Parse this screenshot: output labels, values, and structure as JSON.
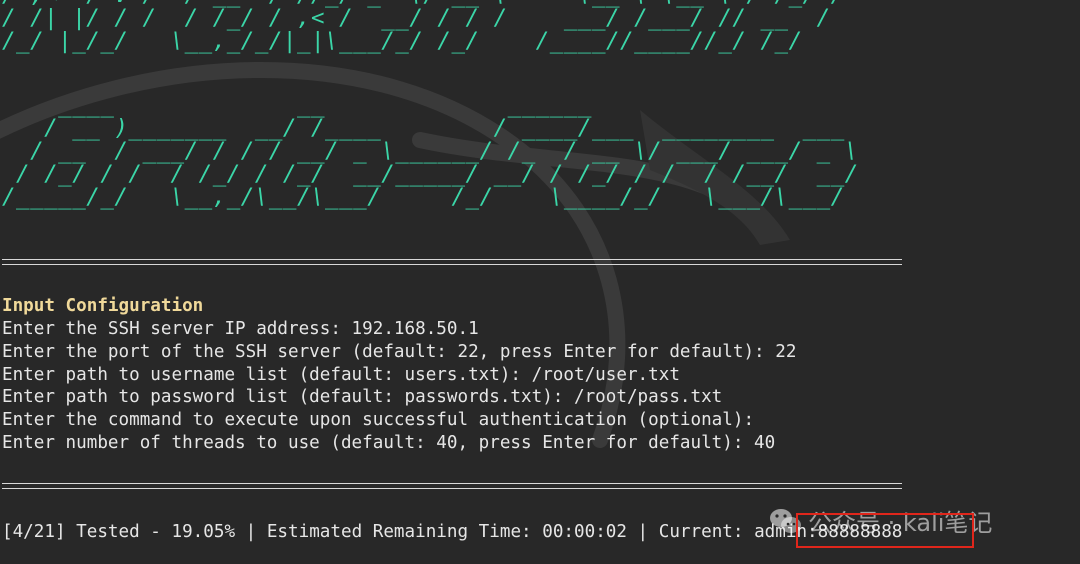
{
  "banner": {
    "title_art": [
      "/ ,<  / V /  / __ `/ //_/ _  \\/ __ \\     \\__ \\ \\__ \\ / /_/ /",
      "/ /| |/ / /  / /_/ / ,< /  __/ / / /    ___/ /___/ // __  /",
      "/_/ |_/_/   \\__,_/_/|_|\\___/_/ /_/    /____//____//_/ /_/"
    ],
    "subtitle_art": [
      "    ____             __             ______",
      "   / __ )_______  __/ /____        / ____/___  ________  ___",
      "  / __  / ___/ / / / __/ _ \\______/ /_  / __ \\/ ___/ ___/ _ \\",
      " / /_/ / /  / /_/ / /_/  __/_____/ __/ / /_/ / /  / /__/  __/",
      "/_____/_/   \\__,_/\\__/\\___/     /_/    \\____/_/   \\___/\\___/"
    ]
  },
  "config": {
    "heading": "Input Configuration",
    "lines": [
      "Enter the SSH server IP address: 192.168.50.1",
      "Enter the port of the SSH server (default: 22, press Enter for default): 22",
      "Enter path to username list (default: users.txt): /root/user.txt",
      "Enter path to password list (default: passwords.txt): /root/pass.txt",
      "Enter the command to execute upon successful authentication (optional):",
      "Enter number of threads to use (default: 40, press Enter for default): 40"
    ]
  },
  "status": {
    "progress_counter": "[4/21]",
    "tested_label": "Tested - 19.05%",
    "progress_value": 0.1905,
    "remaining_label": "Estimated Remaining Time: 00:00:02",
    "current_label": "Current:",
    "current_credential": "admin:88888888"
  },
  "watermark": {
    "text": "公众号 · kali笔记",
    "icon": "wechat-icon"
  },
  "colors": {
    "background": "#282828",
    "banner": "#3bd6a8",
    "heading": "#f0d99a",
    "text": "#e6e6e6",
    "highlight": "#e0261b"
  }
}
